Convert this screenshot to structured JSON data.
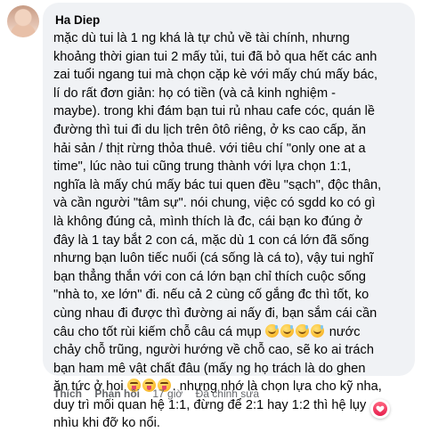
{
  "comment": {
    "author": "Ha Diep",
    "lines": [
      "mặc dù tui là 1 ng khá là tự chủ về tài chính, nhưng",
      "khoảng thời gian tui 2 mấy tủi, tui đã bỏ qua hết các anh",
      "zai tuổi ngang tui mà chọn cặp kè với mấy chú mấy bác,",
      "lí do rất đơn giản: họ có tiền (và cả kinh nghiệm -",
      "maybe). trong khi đám bạn tui rủ nhau cafe cóc, quán lề",
      "đường thì tui đi du lịch trên ôtô riêng, ở ks cao cấp, ăn",
      "hải sản / thịt rừng thỏa thuê. với tiêu chí \"only one at a",
      "time\", lúc nào tui cũng trung thành với lựa chọn 1:1,",
      "nghĩa là mấy chú mấy bác tui quen đều \"sạch\", độc thân,",
      "và cần người \"tâm sự\". nói chung, việc có sgdd ko có gì",
      "là không đúng cả, mình thích là đc, cái bạn ko đúng ở",
      "đây là 1 tay bắt 2 con cá, mặc dù 1 con cá lớn đã sống",
      "nhưng bạn luôn tiếc nuối (cá sống là cá to), vậy tui nghĩ",
      "bạn thẳng thắn với con cá lớn bạn chỉ thích cuộc sống",
      "\"nhà to, xe lớn\" đi. nếu cả 2 cùng cố gắng đc thì tốt, ko",
      "cùng nhau đi được thì đường ai nấy đi, bạn sắm cái cần",
      "câu cho tốt rùi kiếm chỗ câu cá mụp"
    ],
    "line_17_tail": "nước",
    "lines_after": [
      "chảy chỗ trũng, người hướng về chỗ cao, sẽ ko ai trách",
      "bạn ham mê vật chất đâu (mấy ng họ trách là do ghen"
    ],
    "line_20_head": "ăn tức ở hoi",
    "line_20_tail": ". nhưng nhớ là chọn lựa cho kỹ nha,",
    "lines_final": [
      "duy trì mối quan hệ 1:1, đừng để 2:1 hay 1:2 thì hệ lụy",
      "nhìu khi đỡ ko nổi."
    ],
    "emoji_group_1": [
      "sweat-smile",
      "sweat-smile",
      "sweat-smile",
      "sweat-smile"
    ],
    "emoji_group_2": [
      "squint-tongue",
      "squint-tongue",
      "squint-tongue"
    ]
  },
  "actions": {
    "like": "Thích",
    "reply": "Phản hồi",
    "time": "17 giờ",
    "edited": "Đã chỉnh sửa"
  },
  "reaction": {
    "icon": "heart-icon",
    "color": "#e61e4d"
  },
  "colors": {
    "bubble": "#f0f2f5",
    "text": "#050505",
    "meta": "#65676b"
  }
}
